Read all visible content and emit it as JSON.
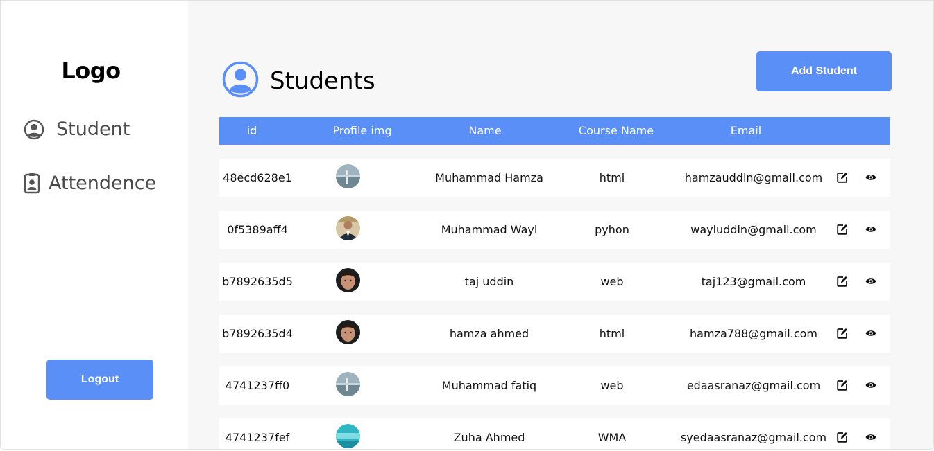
{
  "sidebar": {
    "logo": "Logo",
    "nav": [
      {
        "label": "Student",
        "icon": "user-circle-icon"
      },
      {
        "label": "Attendence",
        "icon": "id-badge-icon"
      }
    ],
    "logout_label": "Logout"
  },
  "header": {
    "title": "Students",
    "icon": "user-circle-icon",
    "add_button_label": "Add Student"
  },
  "table": {
    "columns": [
      "id",
      "Profile img",
      "Name",
      "Course Name",
      "Email"
    ],
    "rows": [
      {
        "id": "48ecd628e1",
        "name": "Muhammad Hamza",
        "course": "html",
        "email": "hamzauddin@gmail.com",
        "avatar": "landscape"
      },
      {
        "id": "0f5389aff4",
        "name": "Muhammad Wayl",
        "course": "pyhon",
        "email": "wayluddin@gmail.com",
        "avatar": "person-suit"
      },
      {
        "id": "b7892635d5",
        "name": "taj uddin",
        "course": "web",
        "email": "taj123@gmail.com",
        "avatar": "face"
      },
      {
        "id": "b7892635d4",
        "name": "hamza ahmed",
        "course": "html",
        "email": "hamza788@gmail.com",
        "avatar": "face"
      },
      {
        "id": "4741237ff0",
        "name": "Muhammad fatiq",
        "course": "web",
        "email": "edaasranaz@gmail.com",
        "avatar": "landscape"
      },
      {
        "id": "4741237fef",
        "name": "Zuha Ahmed",
        "course": "WMA",
        "email": "syedaasranaz@gmail.com",
        "avatar": "water"
      }
    ],
    "row_actions": [
      "edit-icon",
      "view-eye-icon"
    ]
  },
  "colors": {
    "accent": "#5b8ff8",
    "page_bg": "#f7f7f7",
    "sidebar_bg": "#ffffff"
  }
}
